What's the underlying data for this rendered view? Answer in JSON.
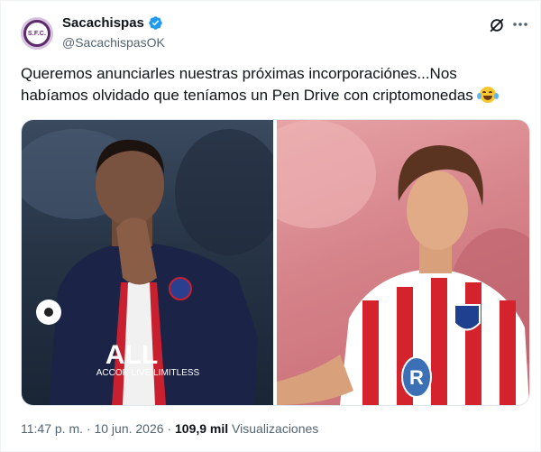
{
  "author": {
    "display_name": "Sacachispas",
    "handle": "@SacachispasOK",
    "avatar_label": "S.F.C.",
    "verified_icon": "verified-badge-icon"
  },
  "tweet": {
    "text": "Queremos anunciarles nuestras próximas incorporaciónes...Nos habíamos olvidado que teníamos un Pen Drive con criptomonedas",
    "emoji": "face-with-tears-of-joy"
  },
  "media": {
    "left_jersey_text": "ACCOR LIVE LIMITLESS",
    "left_jersey_letters": "ALL",
    "right_sponsor_letter": "R"
  },
  "meta": {
    "time": "11:47 p. m.",
    "separator": "·",
    "date": "10 jun. 2026",
    "views_count": "109,9 mil",
    "views_label": "Visualizaciones"
  },
  "colors": {
    "accent": "#1d9bf0",
    "text_primary": "#0f1419",
    "text_secondary": "#536471"
  }
}
